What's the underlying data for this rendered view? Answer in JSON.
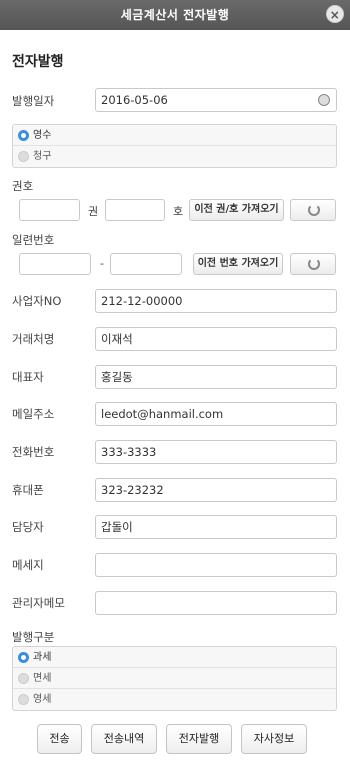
{
  "window": {
    "title": "세금계산서 전자발행"
  },
  "form": {
    "section_title": "전자발행",
    "issue_date": {
      "label": "발행일자",
      "value": "2016-05-06"
    },
    "receipt_type": {
      "options": [
        "영수",
        "청구"
      ],
      "selected": "영수"
    },
    "volume_no": {
      "label": "권호",
      "volume_suffix": "권",
      "number_suffix": "호",
      "volume_value": "",
      "number_value": "",
      "fetch_button": "이전 권/호 가져오기"
    },
    "serial_no": {
      "label": "일련번호",
      "separator": "-",
      "part1": "",
      "part2": "",
      "fetch_button": "이전 번호 가져오기"
    },
    "business_no": {
      "label": "사업자NO",
      "value": "212-12-00000"
    },
    "client_name": {
      "label": "거래처명",
      "value": "이재석"
    },
    "representative": {
      "label": "대표자",
      "value": "홍길동"
    },
    "email": {
      "label": "메일주소",
      "value": "leedot@hanmail.com"
    },
    "phone": {
      "label": "전화번호",
      "value": "333-3333"
    },
    "mobile": {
      "label": "휴대폰",
      "value": "323-23232"
    },
    "manager": {
      "label": "담당자",
      "value": "갑돌이"
    },
    "message": {
      "label": "메세지",
      "value": ""
    },
    "admin_memo": {
      "label": "관리자메모",
      "value": ""
    },
    "tax_type": {
      "label": "발행구분",
      "options": [
        "과세",
        "면세",
        "영세"
      ],
      "selected": "과세"
    }
  },
  "actions": {
    "send": "전송",
    "send_history": "전송내역",
    "e_issue": "전자발행",
    "company_info": "자사정보"
  },
  "colors": {
    "titlebar": "#5f5f5f",
    "radio_selected": "#3a8de0"
  }
}
